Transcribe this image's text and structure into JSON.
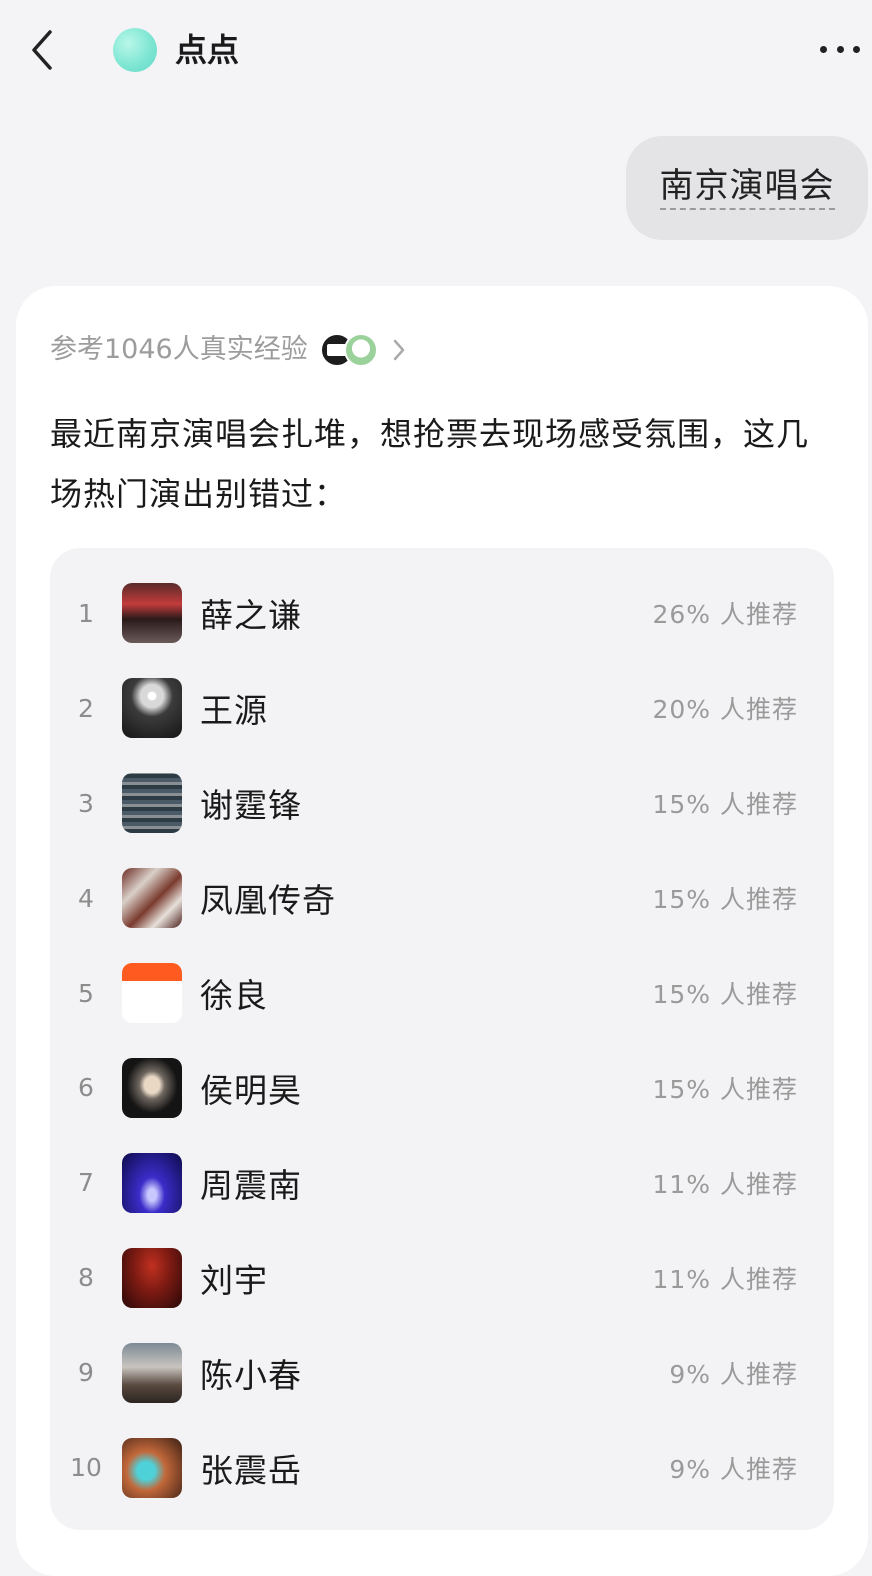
{
  "header": {
    "bot_name": "点点"
  },
  "user_message": {
    "text": "南京演唱会"
  },
  "answer": {
    "reference_text": "参考1046人真实经验",
    "intro_text": "最近南京演唱会扎堆，想抢票去现场感受氛围，这几场热门演出别错过：",
    "ranking": [
      {
        "rank": "1",
        "name": "薛之谦",
        "pct": "26% 人推荐",
        "thumb": "red-stage-crowd"
      },
      {
        "rank": "2",
        "name": "王源",
        "pct": "20% 人推荐",
        "thumb": "arena-lights"
      },
      {
        "rank": "3",
        "name": "谢霆锋",
        "pct": "15% 人推荐",
        "thumb": "stadium-crowd"
      },
      {
        "rank": "4",
        "name": "凤凰传奇",
        "pct": "15% 人推荐",
        "thumb": "ticket-stubs"
      },
      {
        "rank": "5",
        "name": "徐良",
        "pct": "15% 人推荐",
        "thumb": "orange-ticket-page"
      },
      {
        "rank": "6",
        "name": "侯明昊",
        "pct": "15% 人推荐",
        "thumb": "performer-on-stage"
      },
      {
        "rank": "7",
        "name": "周震南",
        "pct": "11% 人推荐",
        "thumb": "blue-arena"
      },
      {
        "rank": "8",
        "name": "刘宇",
        "pct": "11% 人推荐",
        "thumb": "red-dark-arena"
      },
      {
        "rank": "9",
        "name": "陈小春",
        "pct": "9% 人推荐",
        "thumb": "venue-crowd"
      },
      {
        "rank": "10",
        "name": "张震岳",
        "pct": "9% 人推荐",
        "thumb": "colorful-crowd"
      }
    ]
  },
  "colors": {
    "page_bg": "#f4f4f6",
    "bubble_bg": "#e4e4e6",
    "card_bg": "#ffffff",
    "panel_bg": "#f3f3f5",
    "muted_text": "#9a9a9a",
    "bot_avatar": "#7fe6d3"
  }
}
